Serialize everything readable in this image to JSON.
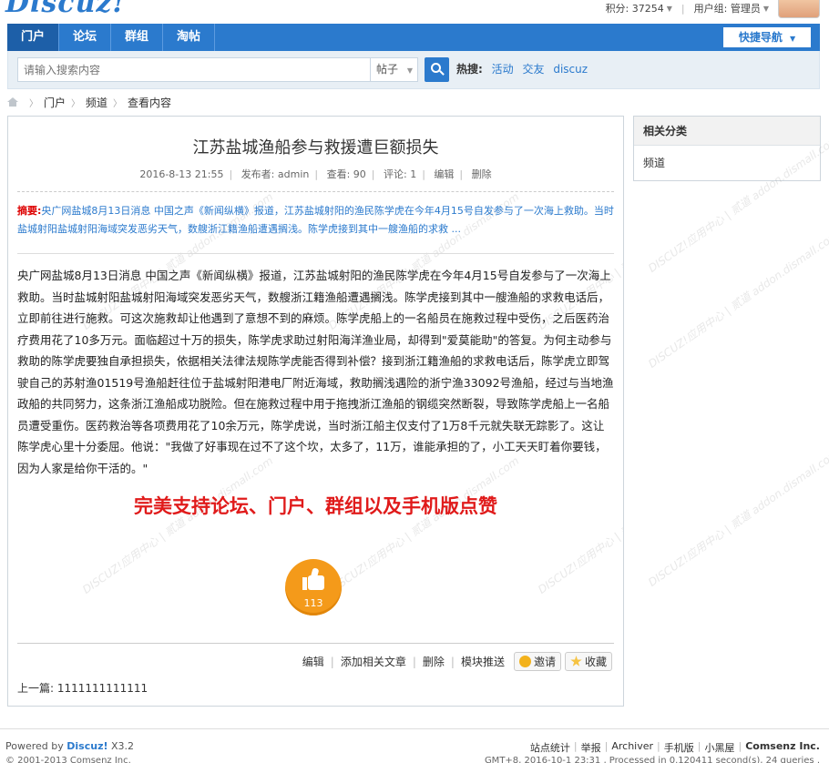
{
  "topbar": {
    "logo": "Discuz!",
    "points": "积分: 37254",
    "usergroup": "用户组: 管理员"
  },
  "nav": {
    "items": [
      {
        "label": "门户",
        "active": true
      },
      {
        "label": "论坛",
        "active": false
      },
      {
        "label": "群组",
        "active": false
      },
      {
        "label": "淘帖",
        "active": false
      }
    ],
    "quick_nav": "快捷导航"
  },
  "search": {
    "placeholder": "请输入搜索内容",
    "type": "帖子",
    "hot_label": "热搜:",
    "hot_keywords": [
      "活动",
      "交友",
      "discuz"
    ]
  },
  "breadcrumb": [
    "门户",
    "频道",
    "查看内容"
  ],
  "article": {
    "title": "江苏盐城渔船参与救援遭巨额损失",
    "date": "2016-8-13 21:55",
    "author": "发布者: admin",
    "views": "查看: 90",
    "comments": "评论: 1",
    "edit": "编辑",
    "delete": "删除",
    "summary_label": "摘要:",
    "summary": "央广网盐城8月13日消息 中国之声《新闻纵横》报道，江苏盐城射阳的渔民陈学虎在今年4月15号自发参与了一次海上救助。当时盐城射阳盐城射阳海域突发恶劣天气，数艘浙江籍渔船遭遇搁浅。陈学虎接到其中一艘渔船的求救 ...",
    "body": "央广网盐城8月13日消息 中国之声《新闻纵横》报道，江苏盐城射阳的渔民陈学虎在今年4月15号自发参与了一次海上救助。当时盐城射阳盐城射阳海域突发恶劣天气，数艘浙江籍渔船遭遇搁浅。陈学虎接到其中一艘渔船的求救电话后，立即前往进行施救。可这次施救却让他遇到了意想不到的麻烦。陈学虎船上的一名船员在施救过程中受伤，之后医药治疗费用花了10多万元。面临超过十万的损失，陈学虎求助过射阳海洋渔业局，却得到\"爱莫能助\"的答复。为何主动参与救助的陈学虎要独自承担损失，依据相关法律法规陈学虎能否得到补偿？接到浙江籍渔船的求救电话后，陈学虎立即驾驶自己的苏射渔01519号渔船赶往位于盐城射阳港电厂附近海域，救助搁浅遇险的浙宁渔33092号渔船，经过与当地渔政船的共同努力，这条浙江渔船成功脱险。但在施救过程中用于拖拽浙江渔船的钢缆突然断裂，导致陈学虎船上一名船员遭受重伤。医药救治等各项费用花了10余万元，陈学虎说，当时浙江船主仅支付了1万8千元就失联无踪影了。这让陈学虎心里十分委屈。他说：\"我做了好事现在过不了这个坎，太多了，11万，谁能承担的了，小工天天盯着你要钱，因为人家是给你干活的。\"",
    "promo": "完美支持论坛、门户、群组以及手机版点赞",
    "like_count": "113",
    "actions": {
      "edit": "编辑",
      "add_related": "添加相关文章",
      "delete": "删除",
      "push": "模块推送",
      "invite": "邀请",
      "favorite": "收藏"
    },
    "prev": "上一篇: 1111111111111"
  },
  "sidebar": {
    "title": "相关分类",
    "items": [
      "频道"
    ]
  },
  "watermark": "DISCUZ!应用中心 | 贰道 addon.dismall.com",
  "footer": {
    "powered_prefix": "Powered by",
    "powered_brand": "Discuz!",
    "powered_version": "X3.2",
    "copyright": "© 2001-2013 Comsenz Inc.",
    "links": [
      "站点统计",
      "举报",
      "Archiver",
      "手机版",
      "小黑屋"
    ],
    "company": "Comsenz Inc.",
    "stats": "GMT+8, 2016-10-1 23:31 , Processed in 0.120411 second(s), 24 queries ."
  }
}
